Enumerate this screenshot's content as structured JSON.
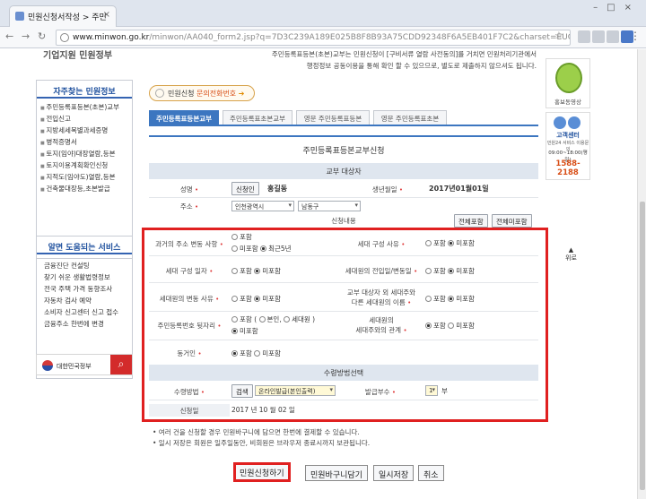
{
  "browser": {
    "tab_title": "민원신청서작성 > 주민",
    "url_host": "www.minwon.go.kr",
    "url_path": "/minwon/AA040_form2.jsp?q=7D3C239A189E025B8F8B93A75CDD92348F6A5EB401F7C2&charset=EUC-KR"
  },
  "left": {
    "top_cut": "기업지원 민원정부",
    "frequent_title": "자주찾는 민원정보",
    "frequent_items": [
      "주민등록표등본(초본)교부",
      "전입신고",
      "지방세세목별과세증명",
      "병적증명서",
      "토지(임야)대장열람,등본",
      "토지이용계획확인신청",
      "지적도(임야도)열람,등본",
      "건축물대장등,초본발급"
    ],
    "services_title": "알면 도움되는 서비스",
    "services_items": [
      "금융진단 컨설팅",
      "찾기 쉬운 생활법령정보",
      "전국 주택 가격 동향조사",
      "자동차 검사 예약",
      "소비자 신고센터 신고 접수",
      "금융주소 한번에 변경"
    ],
    "gov_label": "대한민국정부"
  },
  "center": {
    "intro_line1": "주민등록표등본(초본)교부는 민원신청이 [구비서류 열람 사전동의]를 거치면 민원처리기관에서",
    "intro_line2": "행정정보 공동이용을 통해 확인 할 수 있으므로, 별도로 제출하지 않으셔도 됩니다.",
    "call_prefix": "민원신청",
    "call_highlight": "문의전화번호",
    "tabs": [
      "주민등록표등본교부",
      "주민등록표초본교부",
      "영문 주민등록표등본",
      "영문 주민등록표초본"
    ],
    "form_title": "주민등록표등본교부신청",
    "section_target": "교부 대상자",
    "name_label": "성명",
    "auth_button": "신청인",
    "name_value": "홍길동",
    "birth_label": "생년월일",
    "birth_value": "2017년01월01일",
    "address_label": "주소",
    "address_city": "인천광역시",
    "address_district": "남동구",
    "section_content": "신청내용",
    "include_all": "전체포함",
    "exclude_all": "전체미포함",
    "opt_include": "포함",
    "opt_exclude": "미포함",
    "opt_recent": "최근5년",
    "opt_self": "본인,",
    "opt_household": "세대원",
    "row1_left": "과거의 주소 변동 사항",
    "row1_right": "세대 구성 사유",
    "row2_left": "세대 구성 일자",
    "row2_right": "세대원의 전입일/변동일",
    "row3_left": "세대원의 변동 사유",
    "row3_right_1": "교부 대상자 외 세대주와",
    "row3_right_2": "다른 세대원의 이름",
    "row4_left": "주민등록번호 뒷자리",
    "row4_right_1": "세대원의",
    "row4_right_2": "세대주와의 관계",
    "row5_left": "동거인",
    "section_receive": "수령방법선택",
    "receive_label": "수령방법",
    "search_button": "검색",
    "receive_value": "온라인발급(본인출력)",
    "copies_label": "발급부수",
    "copies_value": "1",
    "copies_unit": "부",
    "date_label": "신청일",
    "date_value": "2017  년 10  월 02  일",
    "note1": "• 여러 건을 신청할 경우 민원바구니에 담으면 한번에 결제할 수 있습니다.",
    "note2": "• 일시 저장은 회원은 일주일동안, 비회원은 브라우저 종료시까지 보관됩니다.",
    "btn_apply": "민원신청하기",
    "btn_basket": "민원바구니담기",
    "btn_save": "일시저장",
    "btn_cancel": "취소"
  },
  "right": {
    "promo_caption": "홍보동영상",
    "center_title": "고객센터",
    "center_sub": "민원24 서비스 이용문의",
    "center_hours": "09:00~18:00(평일)",
    "center_phone": "1588-2188",
    "back_top": "위로"
  }
}
